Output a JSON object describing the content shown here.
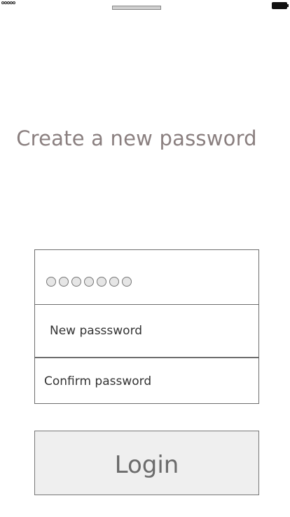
{
  "page": {
    "title": "Create a new password"
  },
  "form": {
    "code_length": 7,
    "new_password_placeholder": "New passsword",
    "confirm_password_placeholder": "Confirm password"
  },
  "actions": {
    "login_label": "Login"
  },
  "icons": {
    "signal": "signal-strength-icon",
    "battery": "battery-icon"
  },
  "colors": {
    "title": "#8a7f7f",
    "button_bg": "#efefef",
    "border": "#6e6e6e"
  }
}
